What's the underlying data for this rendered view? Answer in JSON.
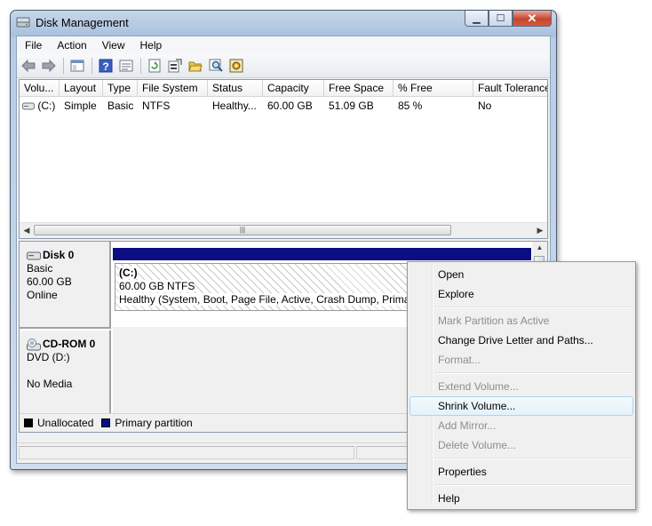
{
  "window": {
    "title": "Disk Management"
  },
  "menu": [
    "File",
    "Action",
    "View",
    "Help"
  ],
  "toolbar_icons": [
    "back-arrow-icon",
    "forward-arrow-icon",
    "console-tree-icon",
    "help-icon",
    "properties-icon",
    "refresh-icon",
    "settings-icon",
    "open-folder-icon",
    "search-icon",
    "wizard-icon"
  ],
  "columns": [
    "Volu...",
    "Layout",
    "Type",
    "File System",
    "Status",
    "Capacity",
    "Free Space",
    "% Free",
    "Fault Tolerance"
  ],
  "volumes": [
    {
      "volume": "(C:)",
      "layout": "Simple",
      "type": "Basic",
      "file_system": "NTFS",
      "status": "Healthy...",
      "capacity": "60.00 GB",
      "free_space": "51.09 GB",
      "pct_free": "85 %",
      "fault_tolerance": "No"
    }
  ],
  "disks": [
    {
      "name": "Disk 0",
      "type": "Basic",
      "size": "60.00 GB",
      "state": "Online",
      "partition": {
        "title": "(C:)",
        "fs": "60.00 GB NTFS",
        "status": "Healthy (System, Boot, Page File, Active, Crash Dump, Primary Partition)"
      }
    },
    {
      "name": "CD-ROM 0",
      "type": "DVD (D:)",
      "state": "No Media"
    }
  ],
  "legend": [
    {
      "label": "Unallocated",
      "color": "#000000"
    },
    {
      "label": "Primary partition",
      "color": "#0a0e80"
    }
  ],
  "context_menu": [
    {
      "label": "Open",
      "enabled": true
    },
    {
      "label": "Explore",
      "enabled": true
    },
    {
      "label": "Mark Partition as Active",
      "enabled": false
    },
    {
      "label": "Change Drive Letter and Paths...",
      "enabled": true
    },
    {
      "label": "Format...",
      "enabled": false
    },
    {
      "label": "Extend Volume...",
      "enabled": false
    },
    {
      "label": "Shrink Volume...",
      "enabled": true,
      "highlighted": true
    },
    {
      "label": "Add Mirror...",
      "enabled": false
    },
    {
      "label": "Delete Volume...",
      "enabled": false
    },
    {
      "label": "Properties",
      "enabled": true
    },
    {
      "label": "Help",
      "enabled": true
    }
  ]
}
